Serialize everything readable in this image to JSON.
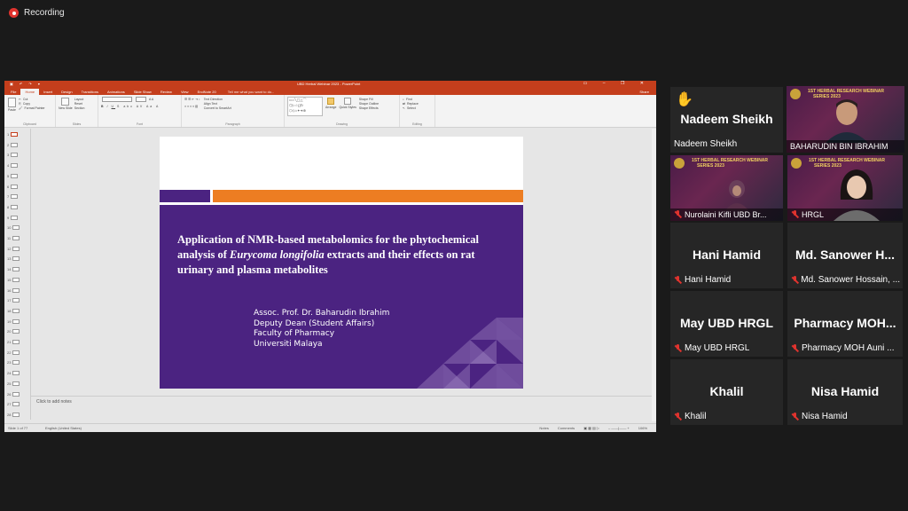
{
  "recording": {
    "label": "Recording"
  },
  "powerpoint": {
    "window_title": "UBD Herbal Webinar 2023 - PowerPoint",
    "tabs": [
      "File",
      "Home",
      "Insert",
      "Design",
      "Transitions",
      "Animations",
      "Slide Show",
      "Review",
      "View",
      "EndNote 20"
    ],
    "active_tab": "Home",
    "tell_me": "Tell me what you want to do...",
    "share": "Share",
    "ribbon_groups": [
      "Clipboard",
      "Slides",
      "Font",
      "Paragraph",
      "Drawing",
      "Editing"
    ],
    "ribbon_labels": {
      "paste": "Paste",
      "cut": "Cut",
      "copy": "Copy",
      "format_painter": "Format Painter",
      "new_slide": "New Slide",
      "layout": "Layout",
      "reset": "Reset",
      "section": "Section",
      "text_direction": "Text Direction",
      "align_text": "Align Text",
      "convert_smartart": "Convert to SmartArt",
      "arrange": "Arrange",
      "quick_styles": "Quick Styles",
      "shape_fill": "Shape Fill",
      "shape_outline": "Shape Outline",
      "shape_effects": "Shape Effects",
      "find": "Find",
      "replace": "Replace",
      "select": "Select"
    },
    "slide_numbers": [
      "1",
      "2",
      "3",
      "4",
      "5",
      "6",
      "7",
      "8",
      "9",
      "10",
      "11",
      "12",
      "13",
      "14",
      "15",
      "16",
      "17",
      "18",
      "19",
      "20",
      "21",
      "22",
      "23",
      "24",
      "25",
      "26",
      "27",
      "28"
    ],
    "slide": {
      "title_part1": "Application of NMR-based metabolomics for the phytochemical analysis of ",
      "title_italic": "Eurycoma longifolia",
      "title_part2": " extracts and their effects on rat urinary and plasma metabolites",
      "presenter_lines": [
        "Assoc. Prof. Dr. Baharudin Ibrahim",
        "Deputy Dean (Student Affairs)",
        "Faculty of Pharmacy",
        "Universiti Malaya"
      ]
    },
    "notes_placeholder": "Click to add notes",
    "status": {
      "slide_of": "Slide 1 of 77",
      "language": "English (United States)",
      "notes": "Notes",
      "comments": "Comments",
      "zoom": "106%"
    },
    "colors": {
      "ppt_red": "#c43e1c",
      "purple": "#4b2381",
      "orange": "#ed7d22"
    }
  },
  "participants": [
    {
      "big_name": "Nadeem Sheikh",
      "label": "Nadeem Sheikh",
      "hand_raised": true,
      "muted": false,
      "video": false
    },
    {
      "big_name": "",
      "label": "BAHARUDIN BIN IBRAHIM",
      "muted": false,
      "video": true,
      "active_speaker": true,
      "banner": "1ST HERBAL RESEARCH WEBINAR",
      "banner2": "SERIES 2023"
    },
    {
      "big_name": "",
      "label": "Nurolaini Kifli UBD Br...",
      "muted": true,
      "video": true,
      "banner": "1ST HERBAL RESEARCH WEBINAR",
      "banner2": "SERIES 2023"
    },
    {
      "big_name": "",
      "label": "HRGL",
      "muted": true,
      "video": true,
      "banner": "1ST HERBAL RESEARCH WEBINAR",
      "banner2": "SERIES 2023"
    },
    {
      "big_name": "Hani Hamid",
      "label": "Hani Hamid",
      "muted": true,
      "video": false
    },
    {
      "big_name": "Md. Sanower H...",
      "label": "Md. Sanower Hossain, ...",
      "muted": true,
      "video": false
    },
    {
      "big_name": "May UBD HRGL",
      "label": "May UBD HRGL",
      "muted": true,
      "video": false
    },
    {
      "big_name": "Pharmacy MOH...",
      "label": "Pharmacy MOH Auni ...",
      "muted": true,
      "video": false
    },
    {
      "big_name": "Khalil",
      "label": "Khalil",
      "muted": true,
      "video": false
    },
    {
      "big_name": "Nisa Hamid",
      "label": "Nisa Hamid",
      "muted": true,
      "video": false
    }
  ]
}
